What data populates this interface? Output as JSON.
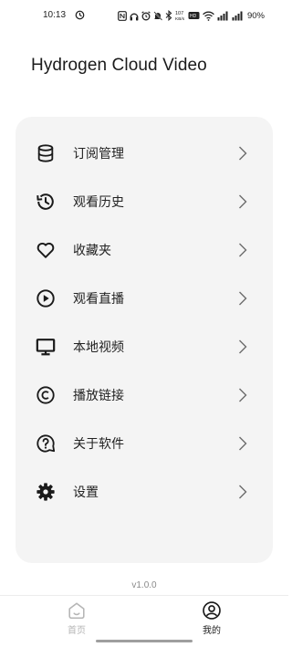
{
  "status_bar": {
    "time": "10:13",
    "battery": "90%",
    "icons": [
      "app-notification-icon",
      "nfc-icon",
      "headphones-icon",
      "alarm-icon",
      "mute-icon",
      "bluetooth-icon",
      "network-speed-icon",
      "volte-icon",
      "wifi-icon",
      "signal-icon",
      "signal-icon",
      "battery-icon"
    ],
    "network_speed": "107\nKB/s"
  },
  "app": {
    "title": "Hydrogen Cloud Video"
  },
  "menu": {
    "items": [
      {
        "label": "订阅管理",
        "icon": "database-icon"
      },
      {
        "label": "观看历史",
        "icon": "history-icon"
      },
      {
        "label": "收藏夹",
        "icon": "heart-icon"
      },
      {
        "label": "观看直播",
        "icon": "play-circle-icon"
      },
      {
        "label": "本地视频",
        "icon": "monitor-icon"
      },
      {
        "label": "播放链接",
        "icon": "copyright-icon"
      },
      {
        "label": "关于软件",
        "icon": "help-circle-icon"
      },
      {
        "label": "设置",
        "icon": "gear-icon"
      }
    ]
  },
  "version": "v1.0.0",
  "bottom_nav": {
    "home_label": "首页",
    "mine_label": "我的",
    "active": "我的"
  },
  "colors": {
    "card_background": "#f4f4f4",
    "text": "#222222",
    "inactive_nav": "#b5b5b5"
  }
}
